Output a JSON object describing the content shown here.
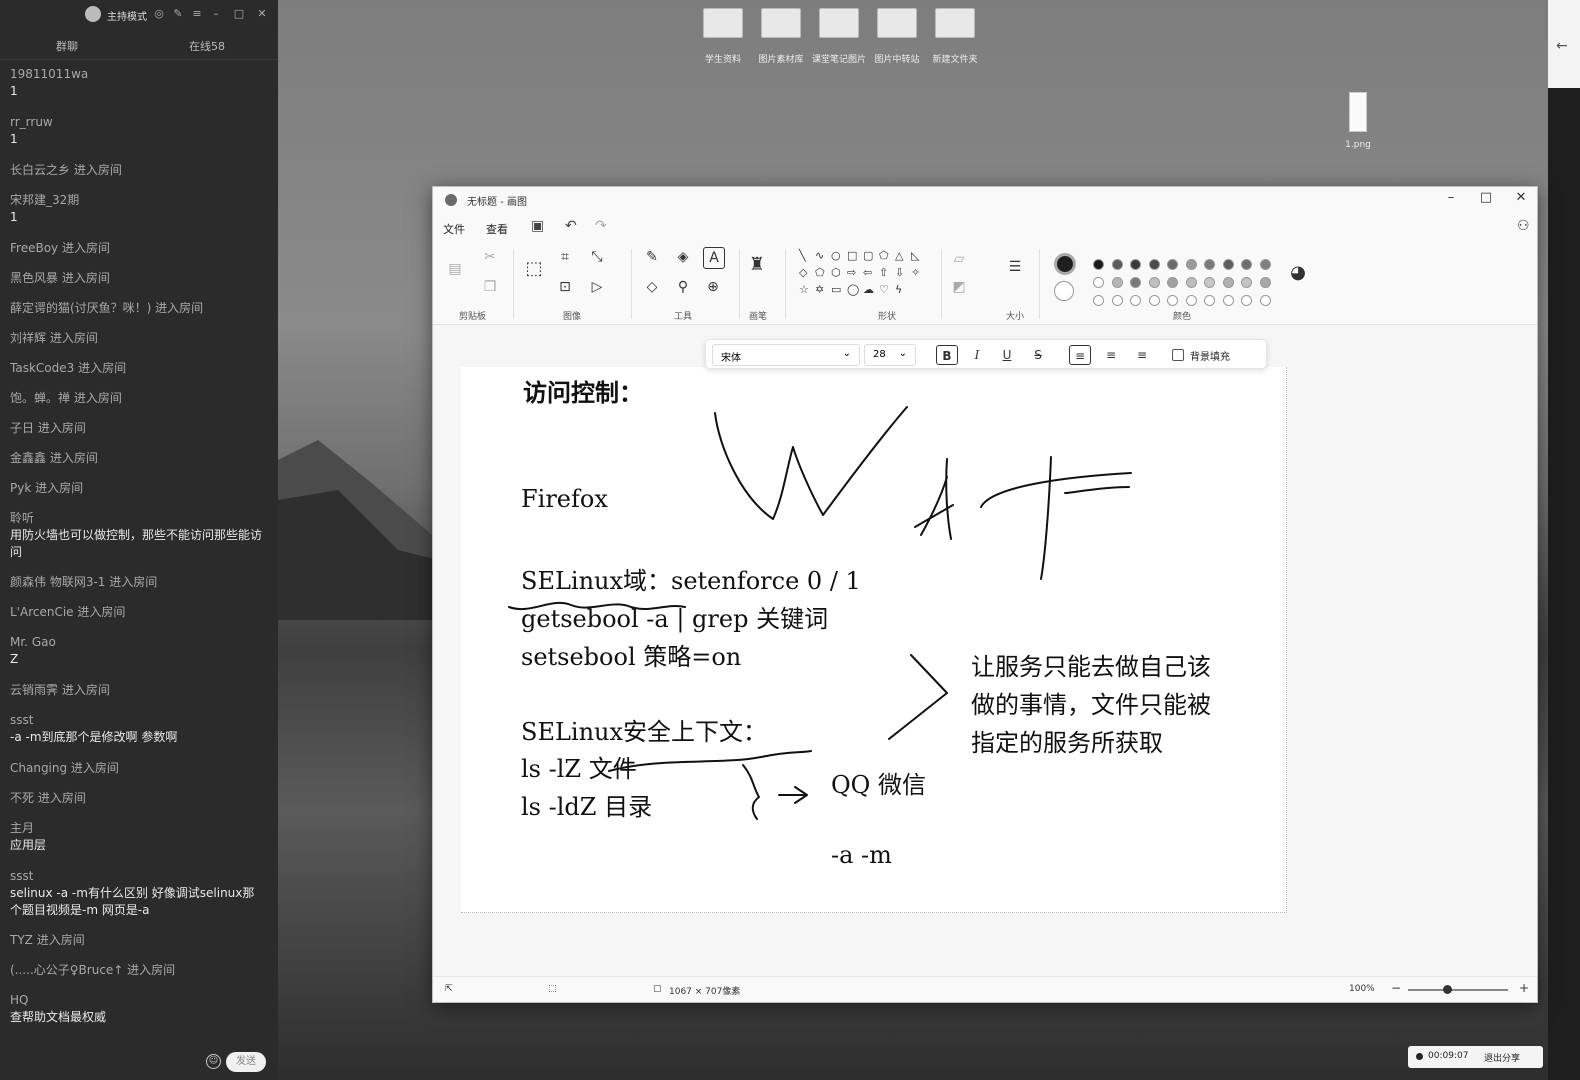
{
  "chat": {
    "title": "主持模式",
    "tabs": [
      "群聊",
      "在线58"
    ],
    "send_label": "发送",
    "messages": [
      {
        "name": "19811011wa",
        "text": "1"
      },
      {
        "name": "rr_rruw",
        "text": "1"
      },
      {
        "name": "长白云之乡 进入房间",
        "text": ""
      },
      {
        "name": "宋邦建_32期",
        "text": "1"
      },
      {
        "name": "FreeBoy 进入房间",
        "text": ""
      },
      {
        "name": "黑色风暴 进入房间",
        "text": ""
      },
      {
        "name": "薛定谔的猫(讨厌鱼？咪！) 进入房间",
        "text": ""
      },
      {
        "name": "刘祥辉 进入房间",
        "text": ""
      },
      {
        "name": "TaskCode3 进入房间",
        "text": ""
      },
      {
        "name": "饱。蝉。禅 进入房间",
        "text": ""
      },
      {
        "name": "子日 进入房间",
        "text": ""
      },
      {
        "name": "金鑫鑫    进入房间",
        "text": ""
      },
      {
        "name": "Pyk 进入房间",
        "text": ""
      },
      {
        "name": "聆听",
        "text": "用防火墙也可以做控制，那些不能访问那些能访问"
      },
      {
        "name": "颜森伟 物联网3-1 进入房间",
        "text": ""
      },
      {
        "name": "L'ArcenCie 进入房间",
        "text": ""
      },
      {
        "name": "Mr. Gao",
        "text": "Z"
      },
      {
        "name": "云销雨霁 进入房间",
        "text": ""
      },
      {
        "name": "ssst",
        "text": "-a -m到底那个是修改啊 参数啊"
      },
      {
        "name": "Changing 进入房间",
        "text": ""
      },
      {
        "name": "不死 进入房间",
        "text": ""
      },
      {
        "name": "主月",
        "text": "应用层"
      },
      {
        "name": "ssst",
        "text": "selinux  -a -m有什么区别  好像调试selinux那个题目视频是-m 网页是-a"
      },
      {
        "name": "TYZ 进入房间",
        "text": ""
      },
      {
        "name": "(.....心公子♀Bruce↑ 进入房间",
        "text": ""
      },
      {
        "name": "HQ",
        "text": "查帮助文档最权威"
      }
    ]
  },
  "desktop": {
    "icons": [
      "学生资料",
      "图片素材库",
      "课堂笔记图片",
      "图片中转站",
      "新建文件夹"
    ],
    "file_icon": "1.png"
  },
  "paint": {
    "title": "无标题 - 画图",
    "menu": [
      "文件",
      "查看"
    ],
    "ribbon_groups": [
      "剪贴板",
      "图像",
      "工具",
      "画笔",
      "形状",
      "大小",
      "颜色"
    ],
    "text_toolbar": {
      "font": "宋体",
      "size": "28",
      "bold": "B",
      "italic": "I",
      "underline": "U",
      "strike": "S",
      "background_fill": "背景填充"
    },
    "canvas_lines": [
      "访问控制：",
      "Firefox",
      "SELinux域：setenforce  0 / 1",
      "getsebool -a | grep 关键词",
      "setsebool 策略=on",
      "SELinux安全上下文：",
      "ls -lZ  文件",
      "ls -ldZ 目录",
      "QQ 微信",
      "-a -m",
      "让服务只能去做自己该",
      "做的事情，文件只能被",
      "指定的服务所获取"
    ],
    "status": {
      "canvas_size": "1067 × 707像素",
      "zoom": "100%"
    }
  },
  "share": {
    "timer": "00:09:07",
    "stop_label": "退出分享"
  },
  "palette_row1": [
    "#1a1a1a",
    "#5a5a5a",
    "#3a3a3a",
    "#4a4a4a",
    "#6a6a6a",
    "#9a9a9a",
    "#7a7a7a",
    "#5c5c5c",
    "#6e6e6e",
    "#808080"
  ],
  "palette_row2": [
    "#ffffff",
    "#b5b5b5",
    "#7a7a7a",
    "#c0c0c0",
    "#a0a0a0",
    "#bdbdbd",
    "#c8c8c8",
    "#b0b0b0",
    "#c4c4c4",
    "#a8a8a8"
  ]
}
